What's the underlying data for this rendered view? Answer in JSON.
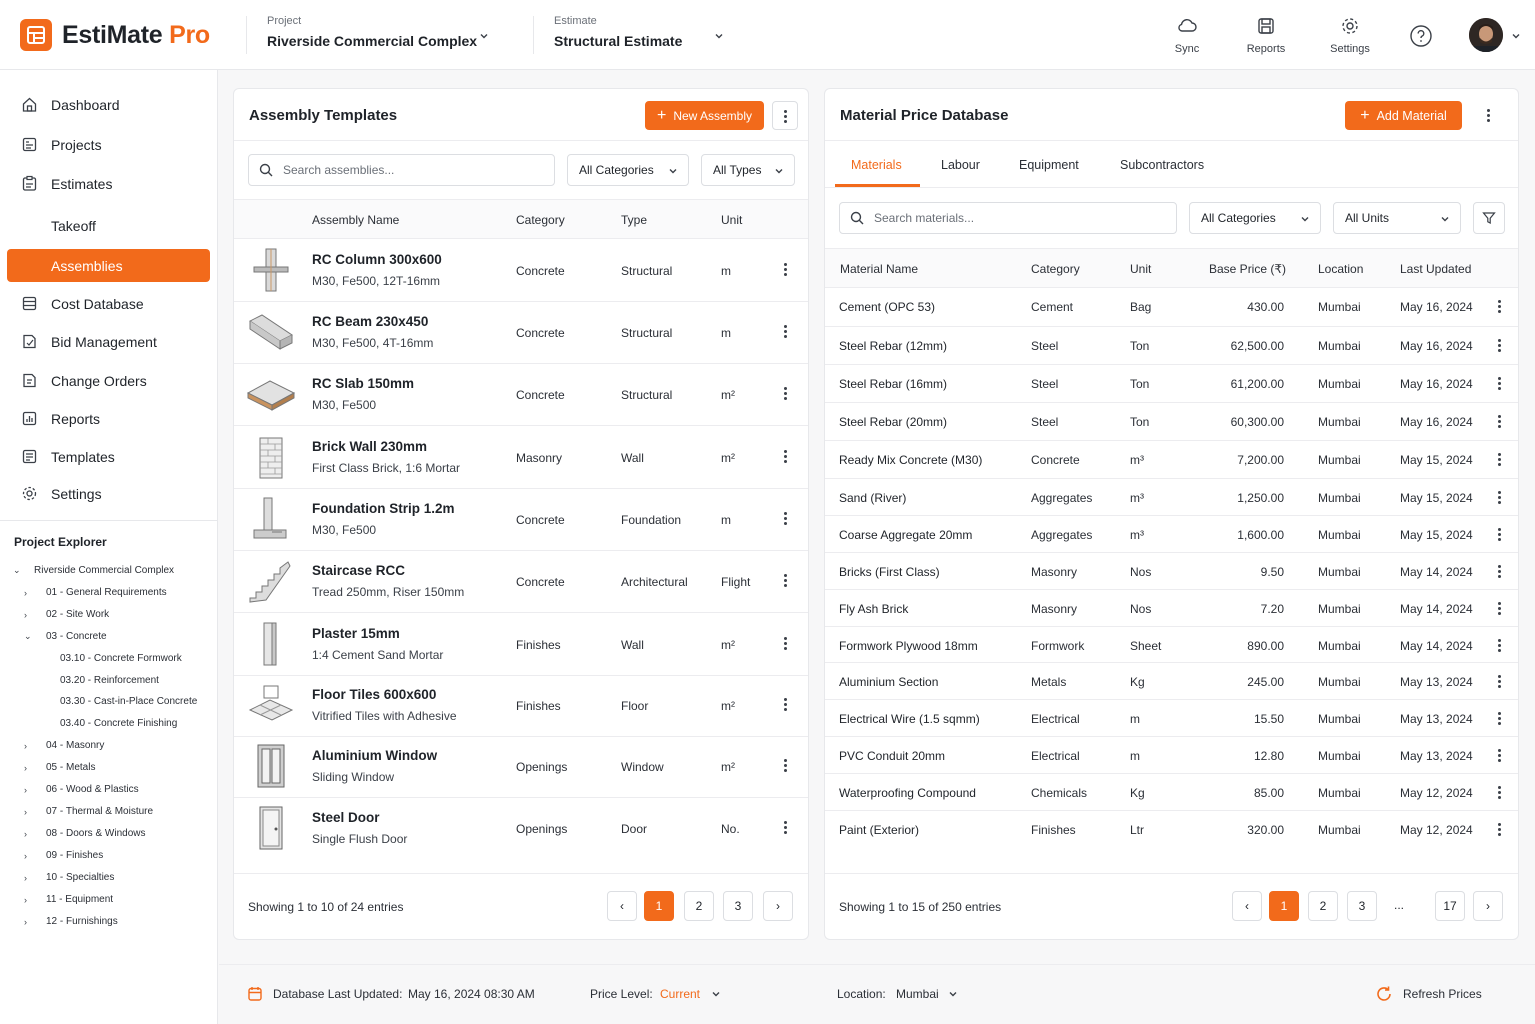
{
  "app": {
    "name_part1": "EstiMate",
    "name_part2": "Pro"
  },
  "header": {
    "project_label": "Project",
    "project_value": "Riverside Commercial Complex",
    "estimate_label": "Estimate",
    "estimate_value": "Structural Estimate",
    "sync": "Sync",
    "reports": "Reports",
    "settings": "Settings"
  },
  "sidebar": {
    "items": [
      {
        "label": "Dashboard",
        "icon": "home-icon"
      },
      {
        "label": "Projects",
        "icon": "projects-icon"
      },
      {
        "label": "Estimates",
        "icon": "estimates-icon"
      },
      {
        "label": "Takeoff",
        "icon": ""
      },
      {
        "label": "Assemblies",
        "icon": ""
      },
      {
        "label": "Cost Database",
        "icon": "database-icon"
      },
      {
        "label": "Bid Management",
        "icon": "bid-icon"
      },
      {
        "label": "Change Orders",
        "icon": "change-orders-icon"
      },
      {
        "label": "Reports",
        "icon": "reports-icon"
      },
      {
        "label": "Templates",
        "icon": "templates-icon"
      },
      {
        "label": "Settings",
        "icon": "gear-icon"
      }
    ],
    "explorer_title": "Project Explorer",
    "tree": [
      "Riverside Commercial Complex",
      "01 - General Requirements",
      "02 - Site Work",
      "03 - Concrete",
      "03.10 - Concrete Formwork",
      "03.20 - Reinforcement",
      "03.30 - Cast-in-Place Concrete",
      "03.40 - Concrete Finishing",
      "04 - Masonry",
      "05 - Metals",
      "06 - Wood & Plastics",
      "07 - Thermal & Moisture",
      "08 - Doors & Windows",
      "09 - Finishes",
      "10 - Specialties",
      "11 - Equipment",
      "12 - Furnishings"
    ]
  },
  "assemblies": {
    "title": "Assembly Templates",
    "new_button": "New Assembly",
    "search_placeholder": "Search assemblies...",
    "category_filter": "All Categories",
    "type_filter": "All Types",
    "columns": [
      "Assembly Name",
      "Category",
      "Type",
      "Unit"
    ],
    "rows": [
      {
        "name": "RC Column 300x600",
        "desc": "M30, Fe500, 12T-16mm",
        "category": "Concrete",
        "type": "Structural",
        "unit": "m"
      },
      {
        "name": "RC Beam 230x450",
        "desc": "M30, Fe500, 4T-16mm",
        "category": "Concrete",
        "type": "Structural",
        "unit": "m"
      },
      {
        "name": "RC Slab 150mm",
        "desc": "M30, Fe500",
        "category": "Concrete",
        "type": "Structural",
        "unit": "m²"
      },
      {
        "name": "Brick Wall 230mm",
        "desc": "First Class Brick, 1:6 Mortar",
        "category": "Masonry",
        "type": "Wall",
        "unit": "m²"
      },
      {
        "name": "Foundation Strip 1.2m",
        "desc": "M30, Fe500",
        "category": "Concrete",
        "type": "Foundation",
        "unit": "m"
      },
      {
        "name": "Staircase RCC",
        "desc": "Tread 250mm, Riser 150mm",
        "category": "Concrete",
        "type": "Architectural",
        "unit": "Flight"
      },
      {
        "name": "Plaster 15mm",
        "desc": "1:4 Cement Sand Mortar",
        "category": "Finishes",
        "type": "Wall",
        "unit": "m²"
      },
      {
        "name": "Floor Tiles 600x600",
        "desc": "Vitrified Tiles with Adhesive",
        "category": "Finishes",
        "type": "Floor",
        "unit": "m²"
      },
      {
        "name": "Aluminium Window",
        "desc": "Sliding Window",
        "category": "Openings",
        "type": "Window",
        "unit": "m²"
      },
      {
        "name": "Steel Door",
        "desc": "Single Flush Door",
        "category": "Openings",
        "type": "Door",
        "unit": "No."
      }
    ],
    "showing": "Showing 1 to 10 of 24 entries",
    "pages": [
      "1",
      "2",
      "3"
    ]
  },
  "materials": {
    "title": "Material Price Database",
    "add_button": "Add Material",
    "tabs": [
      "Materials",
      "Labour",
      "Equipment",
      "Subcontractors"
    ],
    "search_placeholder": "Search materials...",
    "category_filter": "All Categories",
    "unit_filter": "All Units",
    "columns": [
      "Material Name",
      "Category",
      "Unit",
      "Base Price (₹)",
      "Location",
      "Last Updated"
    ],
    "rows": [
      {
        "name": "Cement (OPC 53)",
        "category": "Cement",
        "unit": "Bag",
        "price": "430.00",
        "location": "Mumbai",
        "updated": "May 16, 2024"
      },
      {
        "name": "Steel Rebar (12mm)",
        "category": "Steel",
        "unit": "Ton",
        "price": "62,500.00",
        "location": "Mumbai",
        "updated": "May 16, 2024"
      },
      {
        "name": "Steel Rebar (16mm)",
        "category": "Steel",
        "unit": "Ton",
        "price": "61,200.00",
        "location": "Mumbai",
        "updated": "May 16, 2024"
      },
      {
        "name": "Steel Rebar (20mm)",
        "category": "Steel",
        "unit": "Ton",
        "price": "60,300.00",
        "location": "Mumbai",
        "updated": "May 16, 2024"
      },
      {
        "name": "Ready Mix Concrete (M30)",
        "category": "Concrete",
        "unit": "m³",
        "price": "7,200.00",
        "location": "Mumbai",
        "updated": "May 15, 2024"
      },
      {
        "name": "Sand (River)",
        "category": "Aggregates",
        "unit": "m³",
        "price": "1,250.00",
        "location": "Mumbai",
        "updated": "May 15, 2024"
      },
      {
        "name": "Coarse Aggregate 20mm",
        "category": "Aggregates",
        "unit": "m³",
        "price": "1,600.00",
        "location": "Mumbai",
        "updated": "May 15, 2024"
      },
      {
        "name": "Bricks (First Class)",
        "category": "Masonry",
        "unit": "Nos",
        "price": "9.50",
        "location": "Mumbai",
        "updated": "May 14, 2024"
      },
      {
        "name": "Fly Ash Brick",
        "category": "Masonry",
        "unit": "Nos",
        "price": "7.20",
        "location": "Mumbai",
        "updated": "May 14, 2024"
      },
      {
        "name": "Formwork Plywood 18mm",
        "category": "Formwork",
        "unit": "Sheet",
        "price": "890.00",
        "location": "Mumbai",
        "updated": "May 14, 2024"
      },
      {
        "name": "Aluminium Section",
        "category": "Metals",
        "unit": "Kg",
        "price": "245.00",
        "location": "Mumbai",
        "updated": "May 13, 2024"
      },
      {
        "name": "Electrical Wire (1.5 sqmm)",
        "category": "Electrical",
        "unit": "m",
        "price": "15.50",
        "location": "Mumbai",
        "updated": "May 13, 2024"
      },
      {
        "name": "PVC Conduit 20mm",
        "category": "Electrical",
        "unit": "m",
        "price": "12.80",
        "location": "Mumbai",
        "updated": "May 13, 2024"
      },
      {
        "name": "Waterproofing Compound",
        "category": "Chemicals",
        "unit": "Kg",
        "price": "85.00",
        "location": "Mumbai",
        "updated": "May 12, 2024"
      },
      {
        "name": "Paint (Exterior)",
        "category": "Finishes",
        "unit": "Ltr",
        "price": "320.00",
        "location": "Mumbai",
        "updated": "May 12, 2024"
      }
    ],
    "showing": "Showing 1 to 15 of 250 entries",
    "pages": [
      "1",
      "2",
      "3",
      "...",
      "17"
    ]
  },
  "footer": {
    "db_updated_label": "Database Last Updated:",
    "db_updated_value": "May 16, 2024 08:30 AM",
    "price_level_label": "Price Level:",
    "price_level_value": "Current",
    "location_label": "Location:",
    "location_value": "Mumbai",
    "refresh": "Refresh Prices"
  },
  "colors": {
    "accent": "#f26a1b",
    "text": "#1f2329",
    "border": "#e7e8eb"
  }
}
